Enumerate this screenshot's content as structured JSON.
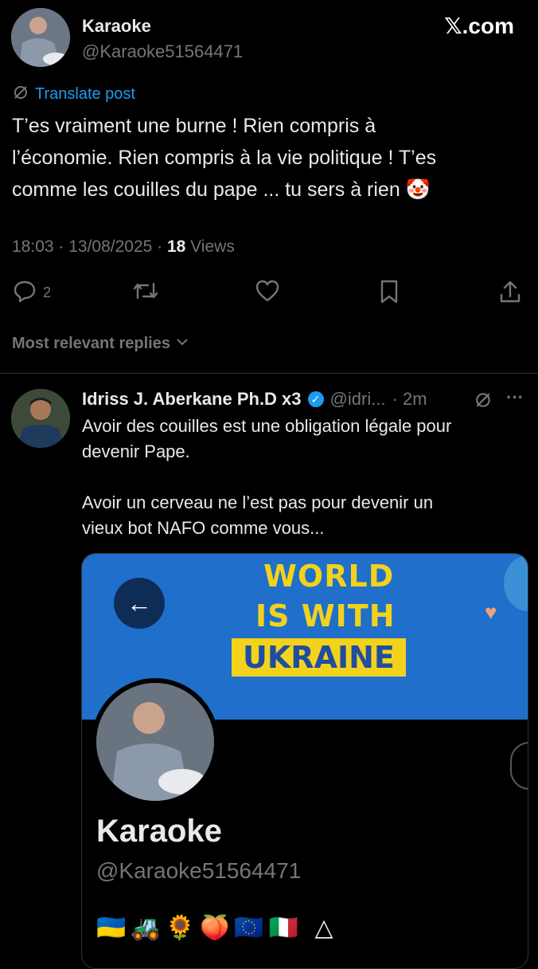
{
  "tweet": {
    "author_name": "Karaoke",
    "author_handle": "@Karaoke51564471",
    "site_label": "𝕏.com",
    "translate_label": "Translate post",
    "text": "T’es vraiment une burne ! Rien compris à\nl’économie. Rien compris à la vie politique ! T’es\ncomme les couilles du pape ... tu sers à rien 🤡",
    "timestamp": "18:03 · 13/08/2025 · ",
    "views_count": "18",
    "views_label": " Views",
    "reply_count": "2"
  },
  "replies_filter": {
    "label": "Most relevant replies"
  },
  "reply": {
    "author_name": "Idriss J. Aberkane Ph.D x3",
    "author_handle": "@idri...",
    "time": "· 2m",
    "text": "Avoir des couilles est une obligation légale pour\ndevenir Pape.\n\nAvoir un cerveau ne l’est pas pour devenir un\nvieux bot NAFO comme vous...",
    "embedded_profile": {
      "banner_line1": "WORLD",
      "banner_line2": "IS WITH",
      "banner_line3": "UKRAINE",
      "name": "Karaoke",
      "handle": "@Karaoke51564471",
      "bio": "🇺🇦🚜🌻🍑🇪🇺🇮🇹 △"
    }
  },
  "colors": {
    "background": "#000000",
    "text": "#e7e9ea",
    "muted": "#71767b",
    "accent": "#1d9bf0",
    "banner_blue": "#1f6fcb",
    "banner_yellow": "#f2d21b"
  },
  "icons": [
    "translate-icon",
    "reply-icon",
    "retweet-icon",
    "like-icon",
    "bookmark-icon",
    "share-icon",
    "chevron-down-icon",
    "verified-icon",
    "more-icon",
    "back-arrow-icon"
  ]
}
